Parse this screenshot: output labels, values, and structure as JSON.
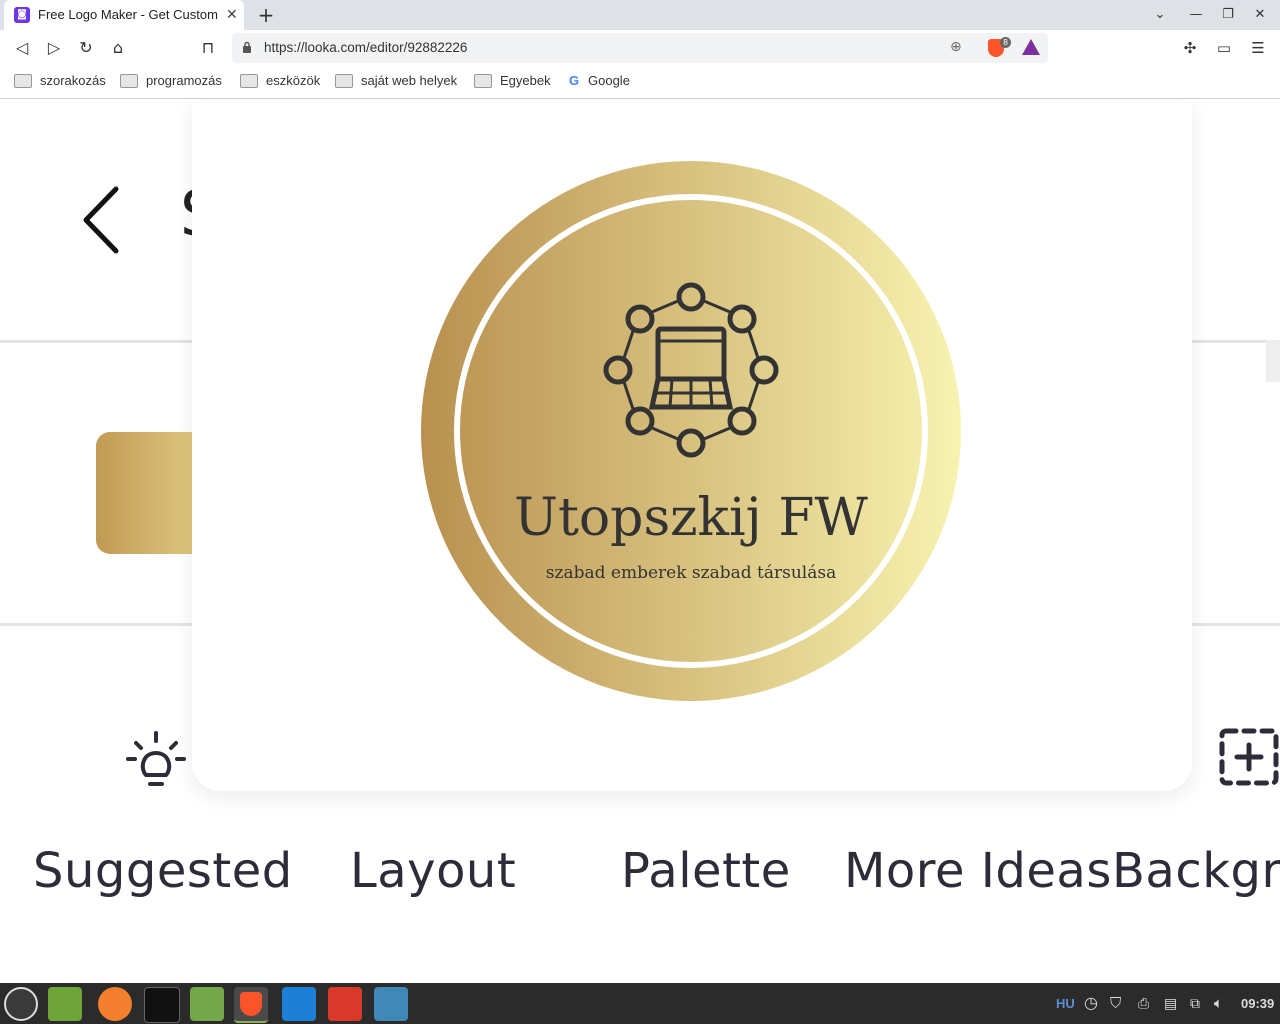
{
  "browser": {
    "tab_title": "Free Logo Maker - Get Custom",
    "tab_close": "✕",
    "new_tab": "+",
    "url": "https://looka.com/editor/92882226",
    "shield_count": "8"
  },
  "bookmarks": [
    "szorakozás",
    "programozás",
    "eszközök",
    "saját web helyek",
    "Egyebek",
    "Google"
  ],
  "page": {
    "behind_heading_initial": "S",
    "bottom_tabs": [
      "Suggested",
      "Layout",
      "Palette",
      "More Ideas",
      "Backgro"
    ]
  },
  "logo": {
    "name": "Utopszkij FW",
    "tagline": "szabad emberek szabad társulása",
    "gradient_start": "#b8904f",
    "gradient_end": "#f8f3b0",
    "text_color": "#333333"
  },
  "taskbar": {
    "keyboard_layout": "HU",
    "clock": "09:39"
  }
}
